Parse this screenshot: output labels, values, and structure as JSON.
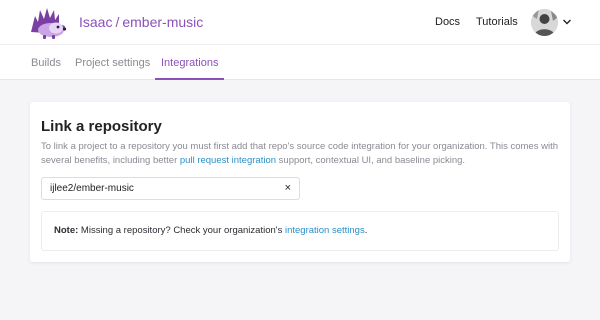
{
  "header": {
    "org": "Isaac",
    "separator": "/",
    "project": "ember-music",
    "docs_label": "Docs",
    "tutorials_label": "Tutorials",
    "logo_icon": "hedgehog-logo-icon",
    "avatar_icon": "user-avatar",
    "caret_icon": "chevron-down-icon"
  },
  "tabs": {
    "builds": "Builds",
    "project_settings": "Project settings",
    "integrations": "Integrations",
    "active": "Integrations"
  },
  "card": {
    "title": "Link a repository",
    "desc_before": "To link a project to a repository you must first add that repo's source code integration for your organization. This comes with several benefits, including better ",
    "desc_link": "pull request integration",
    "desc_after": " support, contextual UI, and baseline picking.",
    "repo_value": "ijlee2/ember-music",
    "clear_symbol": "×",
    "note_label": "Note:",
    "note_text": " Missing a repository? Check your organization's ",
    "note_link": "integration settings",
    "note_end": "."
  },
  "colors": {
    "accent": "#8b51b8",
    "link": "#2d8fc9",
    "background": "#f5f5f8"
  }
}
